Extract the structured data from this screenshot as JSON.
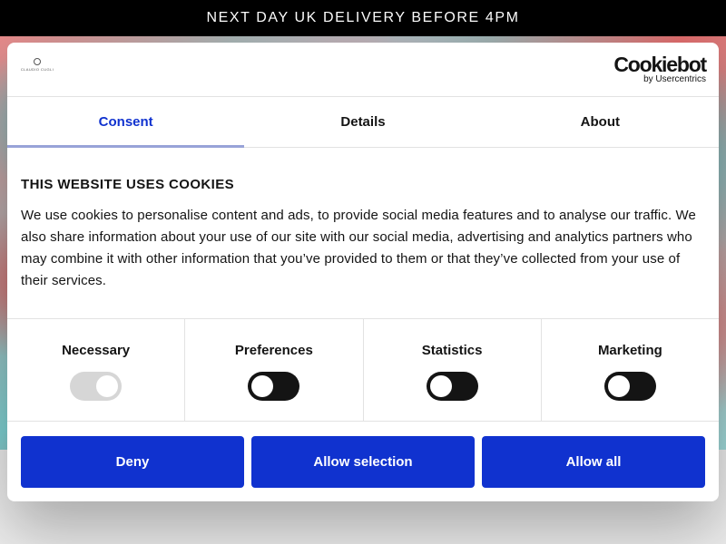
{
  "announcement": {
    "text": "NEXT DAY UK DELIVERY BEFORE 4PM"
  },
  "consent_dialog": {
    "brand_logo_text": "CLAUDIO CUGLI",
    "provider_logo": {
      "name": "Cookiebot",
      "byline": "by Usercentrics"
    },
    "tabs": [
      {
        "label": "Consent",
        "active": true
      },
      {
        "label": "Details",
        "active": false
      },
      {
        "label": "About",
        "active": false
      }
    ],
    "heading": "THIS WEBSITE USES COOKIES",
    "body": "We use cookies to personalise content and ads, to provide social media features and to analyse our traffic. We also share information about your use of our site with our social media, advertising and analytics partners who may combine it with other information that you’ve provided to them or that they’ve collected from your use of their services.",
    "categories": [
      {
        "label": "Necessary",
        "checked": true,
        "disabled": true
      },
      {
        "label": "Preferences",
        "checked": false,
        "disabled": false
      },
      {
        "label": "Statistics",
        "checked": false,
        "disabled": false
      },
      {
        "label": "Marketing",
        "checked": false,
        "disabled": false
      }
    ],
    "buttons": {
      "deny": "Deny",
      "allow_selection": "Allow selection",
      "allow_all": "Allow all"
    },
    "colors": {
      "accent": "#1032cf",
      "toggle_off": "#141414",
      "toggle_disabled": "#d6d6d6",
      "text": "#141414"
    }
  }
}
